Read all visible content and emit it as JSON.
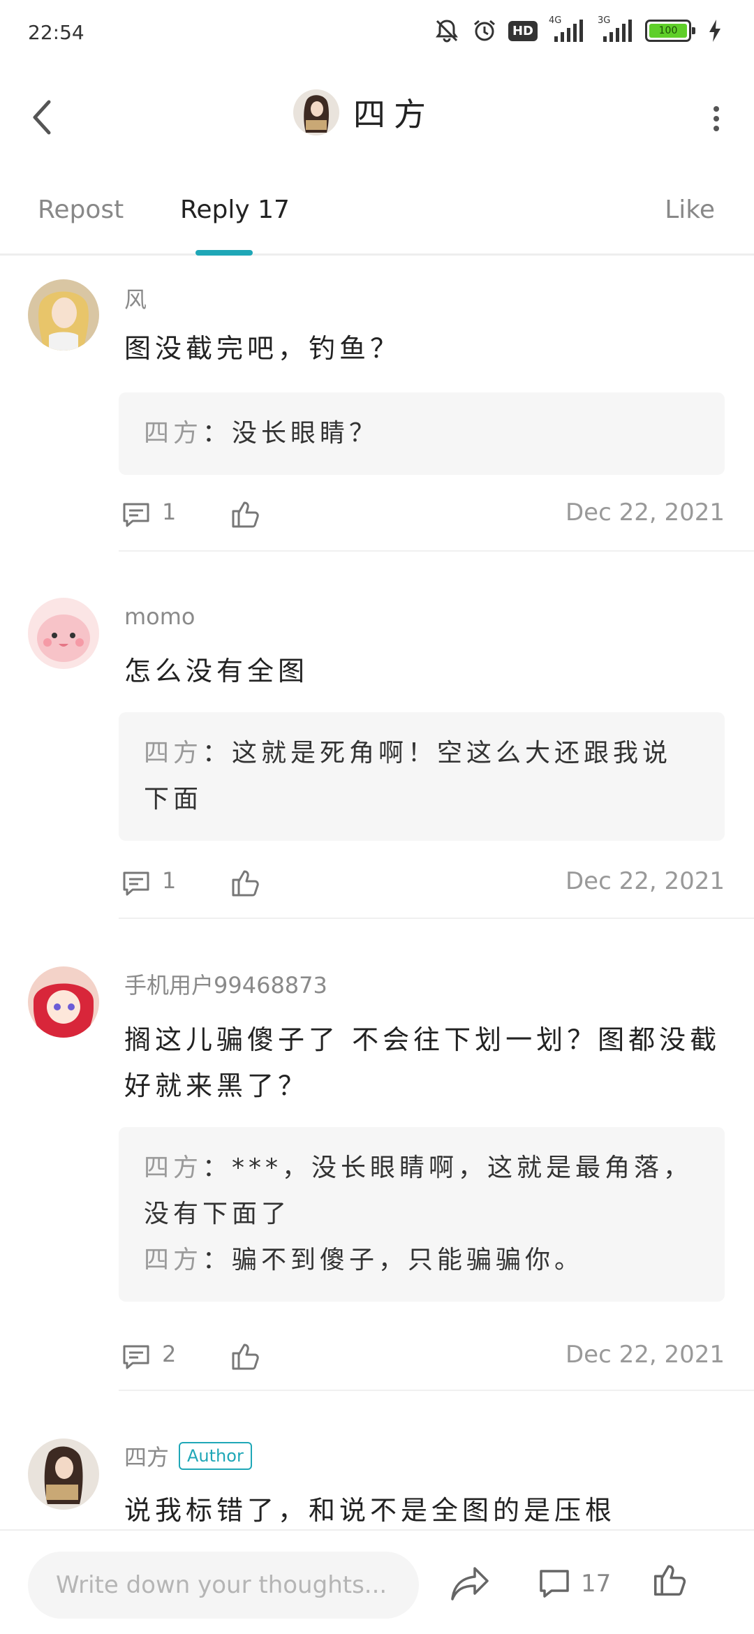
{
  "status_bar": {
    "time": "22:54",
    "hd": "HD",
    "net1": "4G",
    "net2": "3G",
    "battery": "100",
    "icons": [
      "mute-bell-icon",
      "alarm-icon",
      "signal-icon",
      "battery-icon",
      "charging-icon"
    ]
  },
  "header": {
    "title": "四方",
    "back_icon": "back-arrow-icon",
    "more_icon": "more-vertical-icon"
  },
  "tabs": {
    "repost": "Repost",
    "reply": "Reply 17",
    "like": "Like",
    "active": "reply",
    "accent_color": "#1fa7b7"
  },
  "comments": [
    {
      "user": "风",
      "text": "图没截完吧，钓鱼？",
      "replies": [
        {
          "author": "四方",
          "text": "：没长眼睛？"
        }
      ],
      "reply_count": "1",
      "date": "Dec 22, 2021"
    },
    {
      "user": "momo",
      "text": "怎么没有全图",
      "replies": [
        {
          "author": "四方",
          "text": "：这就是死角啊！空这么大还跟我说下面"
        }
      ],
      "reply_count": "1",
      "date": "Dec 22, 2021"
    },
    {
      "user": "手机用户99468873",
      "text": "搁这儿骗傻子了  不会往下划一划？图都没截好就来黑了？",
      "replies": [
        {
          "author": "四方",
          "text": "：***，没长眼睛啊，这就是最角落，没有下面了"
        },
        {
          "author": "四方",
          "text": "：骗不到傻子，只能骗骗你。"
        }
      ],
      "reply_count": "2",
      "date": "Dec 22, 2021"
    },
    {
      "user": "四方",
      "badge": "Author",
      "text": "说我标错了，和说不是全图的是压根"
    }
  ],
  "bottom_bar": {
    "input_placeholder": "Write down your thoughts...",
    "comment_count": "17",
    "icons": [
      "share-icon",
      "comment-icon",
      "like-icon"
    ]
  }
}
